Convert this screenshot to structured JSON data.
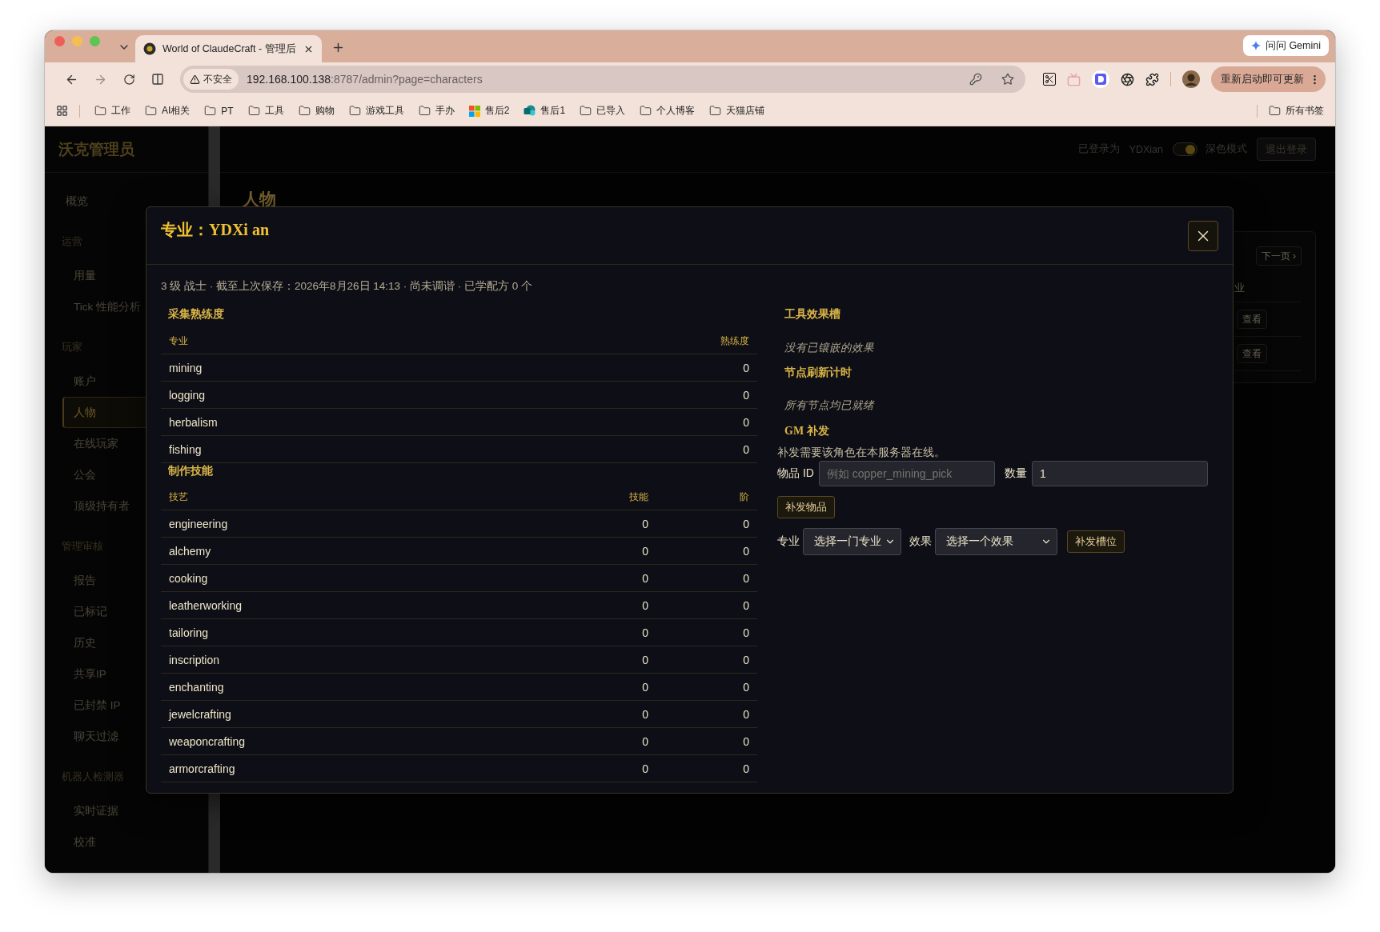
{
  "browser": {
    "tab": {
      "title": "World of ClaudeCraft - 管理后",
      "selected": true
    },
    "gemini_button": "问问 Gemini",
    "address": {
      "security": "不安全",
      "host": "192.168.100.138",
      "path": ":8787/admin?page=characters"
    },
    "update_button": "重新启动即可更新",
    "bookmarks": [
      {
        "label": "工作",
        "kind": "folder"
      },
      {
        "label": "AI相关",
        "kind": "folder"
      },
      {
        "label": "PT",
        "kind": "folder"
      },
      {
        "label": "工具",
        "kind": "folder"
      },
      {
        "label": "购物",
        "kind": "folder"
      },
      {
        "label": "游戏工具",
        "kind": "folder"
      },
      {
        "label": "手办",
        "kind": "folder"
      },
      {
        "label": "售后2",
        "kind": "tiles"
      },
      {
        "label": "售后1",
        "kind": "globe"
      },
      {
        "label": "已导入",
        "kind": "folder"
      },
      {
        "label": "个人博客",
        "kind": "folder"
      },
      {
        "label": "天猫店铺",
        "kind": "folder"
      }
    ],
    "all_bookmarks": "所有书签"
  },
  "sidebar": {
    "brand": "沃克管理员",
    "sections": [
      {
        "items": [
          {
            "label": "概览",
            "selected": false
          }
        ]
      },
      {
        "title": "运营",
        "items": [
          {
            "label": "用量",
            "selected": false
          },
          {
            "label": "Tick 性能分析",
            "selected": false
          }
        ]
      },
      {
        "title": "玩家",
        "items": [
          {
            "label": "账户",
            "selected": false
          },
          {
            "label": "人物",
            "selected": true
          },
          {
            "label": "在线玩家",
            "selected": false
          },
          {
            "label": "公会",
            "selected": false
          },
          {
            "label": "顶级持有者",
            "selected": false
          }
        ]
      },
      {
        "title": "管理审核",
        "items": [
          {
            "label": "报告",
            "selected": false
          },
          {
            "label": "已标记",
            "selected": false
          },
          {
            "label": "历史",
            "selected": false
          },
          {
            "label": "共享IP",
            "selected": false
          },
          {
            "label": "已封禁 IP",
            "selected": false
          },
          {
            "label": "聊天过滤",
            "selected": false
          }
        ]
      },
      {
        "title": "机器人检测器",
        "items": [
          {
            "label": "实时证据",
            "selected": false
          },
          {
            "label": "校准",
            "selected": false
          }
        ]
      }
    ]
  },
  "header": {
    "logged_in_label": "已登录为",
    "user": "YDXian",
    "dark_mode": {
      "label": "深色模式",
      "on": true
    },
    "logout_button": "退出登录"
  },
  "page": {
    "title": "人物",
    "card": {
      "pager_button": "下一页 ›",
      "column": "业",
      "row_buttons": [
        "查看",
        "查看"
      ]
    }
  },
  "modal": {
    "title": "专业：YDXi an",
    "summary": "3 级 战士 · 截至上次保存：2026年8月26日 14:13 · 尚未调谐 · 已学配方 0 个",
    "gathering": {
      "heading": "采集熟练度",
      "columns": [
        "专业",
        "熟练度"
      ],
      "rows": [
        {
          "name": "mining",
          "values": [
            "0"
          ]
        },
        {
          "name": "logging",
          "values": [
            "0"
          ]
        },
        {
          "name": "herbalism",
          "values": [
            "0"
          ]
        },
        {
          "name": "fishing",
          "values": [
            "0"
          ]
        }
      ]
    },
    "crafting": {
      "heading": "制作技能",
      "columns": [
        "技艺",
        "技能",
        "阶"
      ],
      "rows": [
        {
          "name": "engineering",
          "values": [
            "0",
            "0"
          ]
        },
        {
          "name": "alchemy",
          "values": [
            "0",
            "0"
          ]
        },
        {
          "name": "cooking",
          "values": [
            "0",
            "0"
          ]
        },
        {
          "name": "leatherworking",
          "values": [
            "0",
            "0"
          ]
        },
        {
          "name": "tailoring",
          "values": [
            "0",
            "0"
          ]
        },
        {
          "name": "inscription",
          "values": [
            "0",
            "0"
          ]
        },
        {
          "name": "enchanting",
          "values": [
            "0",
            "0"
          ]
        },
        {
          "name": "jewelcrafting",
          "values": [
            "0",
            "0"
          ]
        },
        {
          "name": "weaponcrafting",
          "values": [
            "0",
            "0"
          ]
        },
        {
          "name": "armorcrafting",
          "values": [
            "0",
            "0"
          ]
        }
      ]
    },
    "tool_slots": {
      "heading": "工具效果槽",
      "empty_text": "没有已镶嵌的效果"
    },
    "node_timers": {
      "heading": "节点刷新计时",
      "empty_text": "所有节点均已就绪"
    },
    "gm": {
      "heading": "GM 补发",
      "note": "补发需要该角色在本服务器在线。",
      "item_field": {
        "label": "物品 ID",
        "placeholder": "例如 copper_mining_pick"
      },
      "quantity_field": {
        "label": "数量",
        "value": "1"
      },
      "grant_item_button": "补发物品",
      "profession_select": {
        "label": "专业",
        "value": "选择一门专业"
      },
      "effect_select": {
        "label": "效果",
        "value": "选择一个效果"
      },
      "grant_slot_button": "补发槽位"
    }
  }
}
